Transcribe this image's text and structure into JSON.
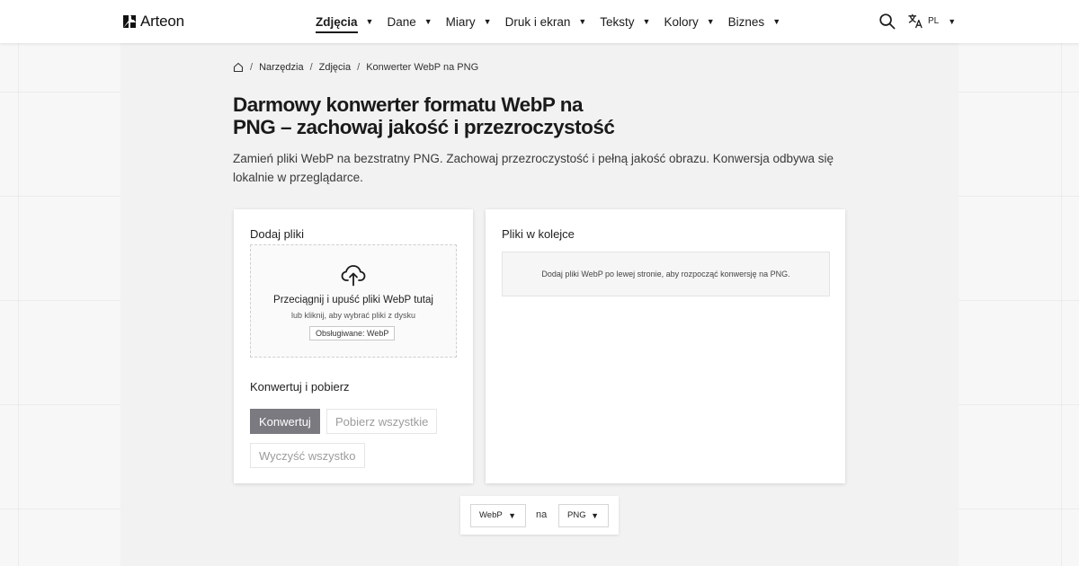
{
  "brand": {
    "name": "Arteon"
  },
  "nav": {
    "items": [
      {
        "label": "Zdjęcia",
        "active": true
      },
      {
        "label": "Dane"
      },
      {
        "label": "Miary"
      },
      {
        "label": "Druk i ekran"
      },
      {
        "label": "Teksty"
      },
      {
        "label": "Kolory"
      },
      {
        "label": "Biznes"
      }
    ],
    "caret": "▼"
  },
  "language": {
    "code": "PL",
    "caret": "▼"
  },
  "icons": {
    "search": "search-icon",
    "language": "translate-icon",
    "home": "home-icon",
    "upload": "cloud-upload-icon"
  },
  "breadcrumb": {
    "separator": "/",
    "items": [
      "Narzędzia",
      "Zdjęcia"
    ],
    "current": "Konwerter WebP na PNG"
  },
  "page": {
    "title_line1": "Darmowy konwerter formatu WebP na",
    "title_line2": "PNG – zachowaj jakość i przezroczystość",
    "description": "Zamień pliki WebP na bezstratny PNG. Zachowaj przezroczystość i pełną jakość obrazu. Konwersja odbywa się lokalnie w przeglądarce."
  },
  "upload": {
    "heading": "Dodaj pliki",
    "drop_title": "Przeciągnij i upuść pliki WebP tutaj",
    "drop_subtitle": "lub kliknij, aby wybrać pliki z dysku",
    "supported": "Obsługiwane: WebP"
  },
  "actions": {
    "heading": "Konwertuj i pobierz",
    "convert": "Konwertuj",
    "download_all": "Pobierz wszystkie",
    "clear_all": "Wyczyść wszystko"
  },
  "queue": {
    "heading": "Pliki w kolejce",
    "empty": "Dodaj pliki WebP po lewej stronie, aby rozpocząć konwersję na PNG."
  },
  "format": {
    "from": "WebP",
    "to_label": "na",
    "to": "PNG",
    "caret": "▼"
  },
  "colors": {
    "accent_button": "#7a7a80",
    "background": "#f7f7f7",
    "panel": "#f2f2f2"
  }
}
